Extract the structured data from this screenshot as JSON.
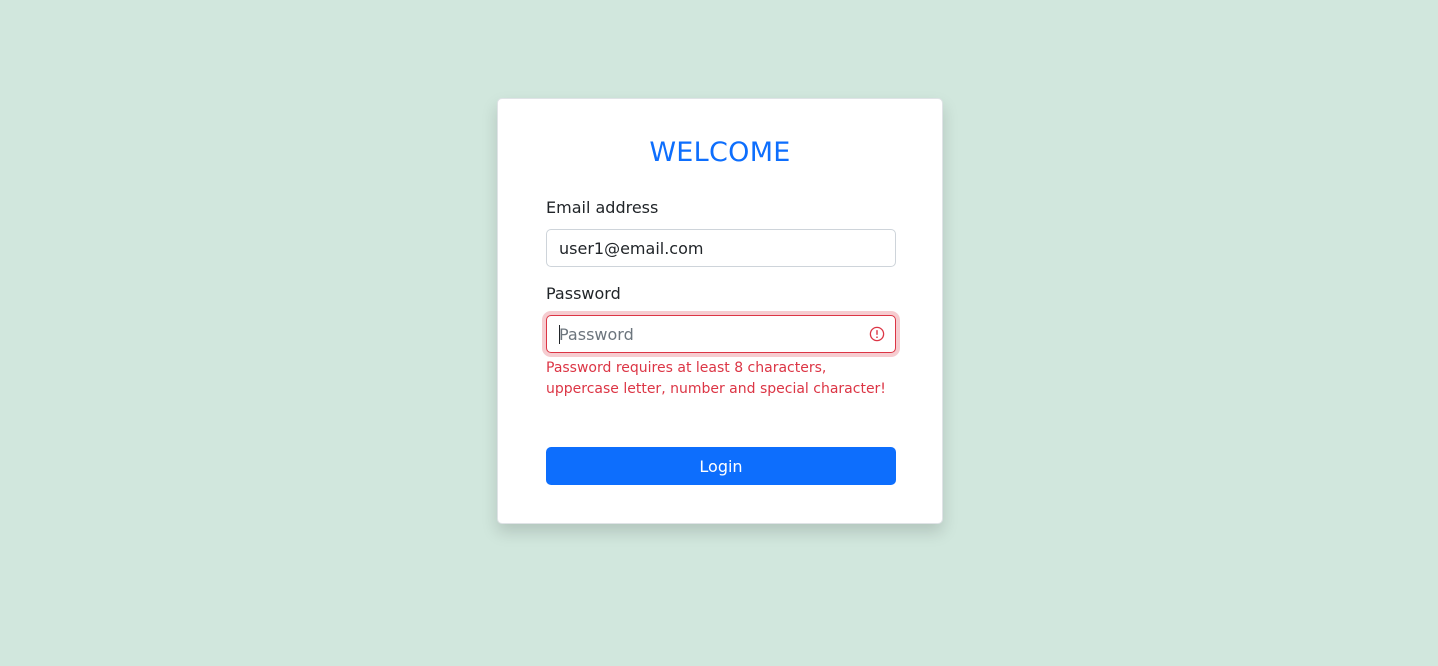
{
  "form": {
    "title": "WELCOME",
    "email_label": "Email address",
    "email_value": "user1@email.com",
    "password_label": "Password",
    "password_placeholder": "Password",
    "password_error": "Password requires at least 8 characters, uppercase letter, number and special character!",
    "login_label": "Login"
  },
  "icons": {
    "password_status": "alert-circle-icon"
  },
  "colors": {
    "background": "#d1e7dd",
    "accent": "#0d6efd",
    "error": "#dc3545"
  }
}
